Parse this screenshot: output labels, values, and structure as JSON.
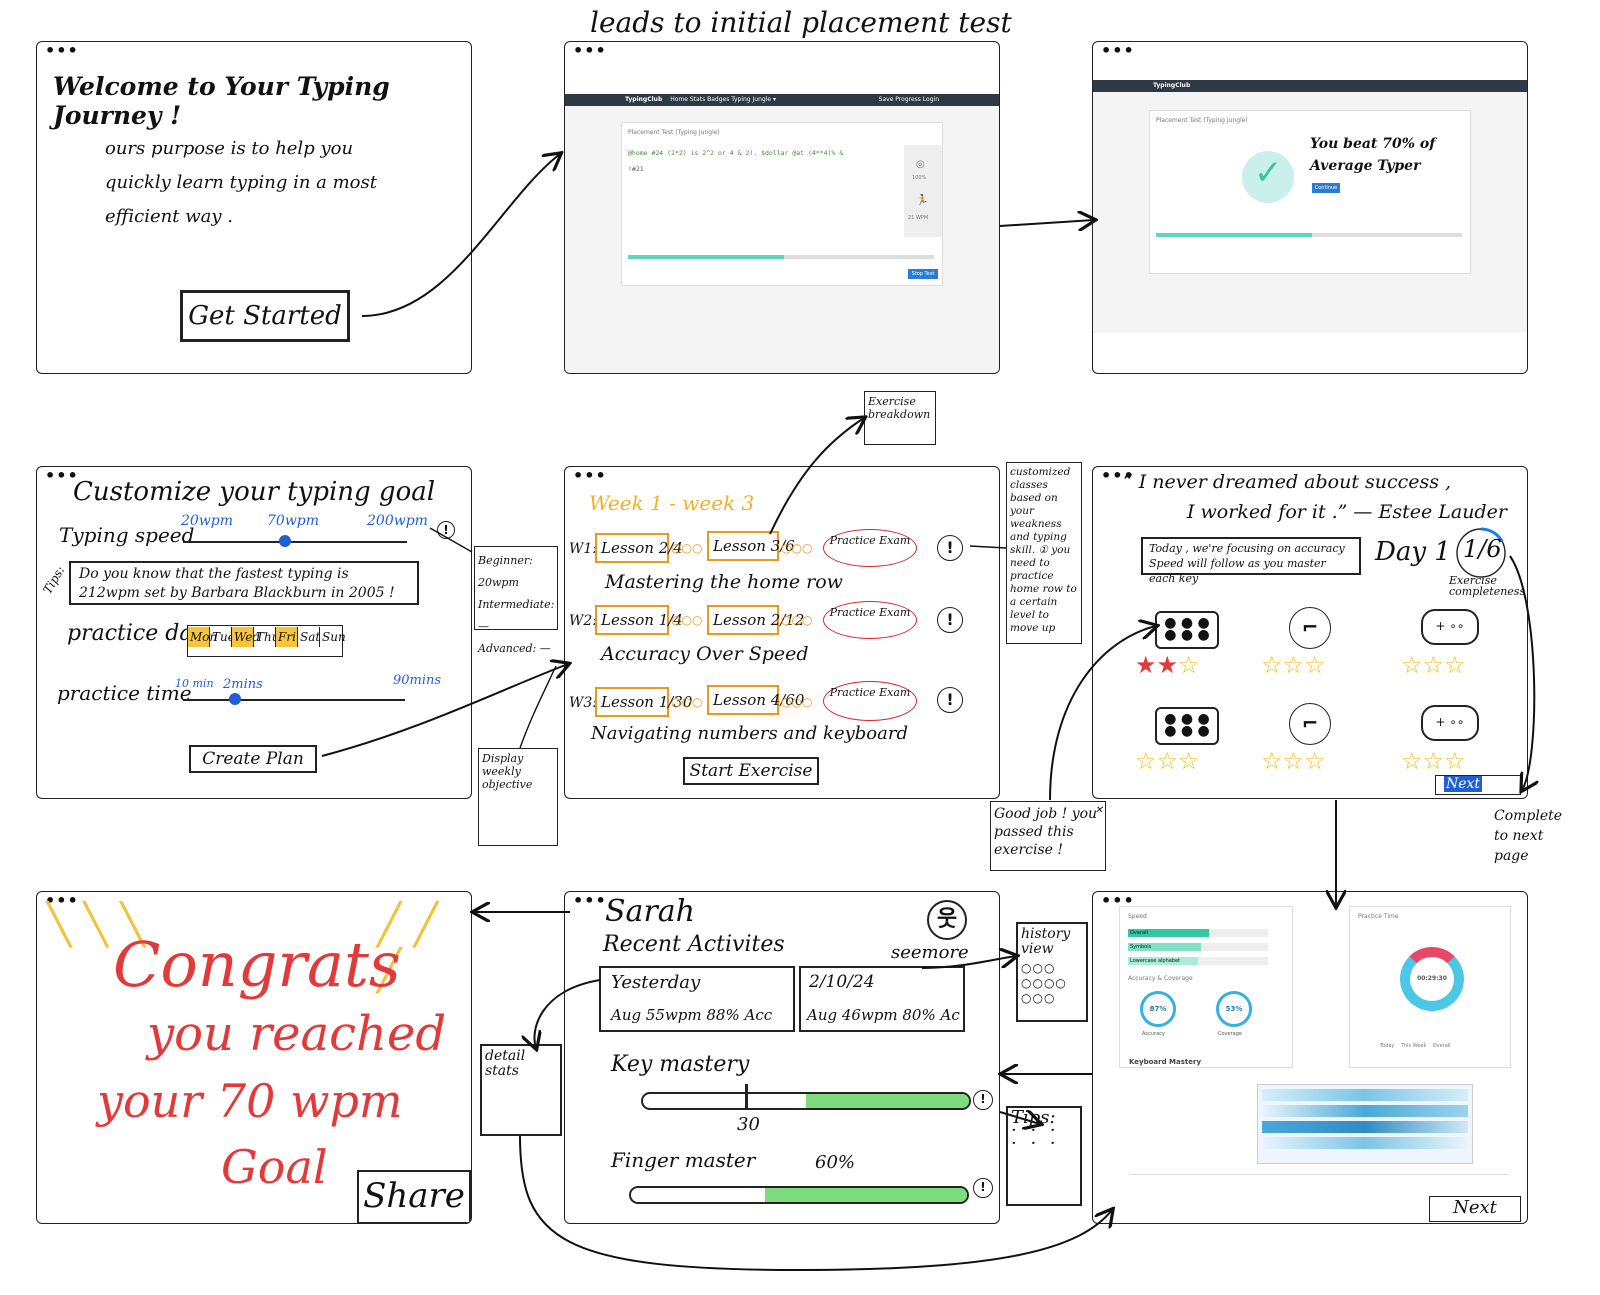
{
  "top_label": "leads to initial placement test",
  "s1": {
    "title": "Welcome to Your Typing Journey !",
    "body": "ours purpose is to help you quickly learn typing in a most efficient way .",
    "button": "Get Started"
  },
  "s2": {
    "brand": "TypingClub",
    "nav": "Home   Stats   Badges   Typing Jungle ▾",
    "nav_right": "Save Progress   Login",
    "card_title": "Placement Test (Typing Jungle)",
    "typing_text": "@home #24 (2*2) is 2^2 or 4 & 2!. $dollar @at (4**4)% &",
    "typing_text2": "!#21",
    "acc": "100%",
    "wpm": "21 WPM",
    "stop": "Stop Test"
  },
  "s3": {
    "brand": "TypingClub",
    "card_title": "Placement Test (Typing Jungle)",
    "result": "You beat 70% of Average Typer",
    "button": "Continue"
  },
  "s4": {
    "title": "Customize your typing goal",
    "speed_label": "Typing speed",
    "speed_ticks": [
      "20wpm",
      "70wpm",
      "200wpm"
    ],
    "tips_label": "Tips:",
    "tip": "Do you know that the fastest typing is 212wpm set by Barbara Blackburn in 2005 !",
    "tip_highlight": "212wpm",
    "practice_day_label": "practice day",
    "days": [
      "Mon",
      "Tue",
      "Wed",
      "Thu",
      "Fri",
      "Sat",
      "Sun"
    ],
    "time_label": "practice time",
    "time_ticks": [
      "10 min",
      "2mins",
      "90mins"
    ],
    "button": "Create Plan",
    "note": [
      "Beginner: 20wpm",
      "Intermediate: —",
      "Advanced: —"
    ]
  },
  "s5": {
    "weeks": "Week 1 - week 3",
    "rows": [
      {
        "w": "W1:",
        "a": "Lesson 2/4",
        "b": "Lesson 3/6",
        "c": "Practice Exam",
        "obj": "Mastering the home row"
      },
      {
        "w": "W2:",
        "a": "Lesson 1/4",
        "b": "Lesson 2/12",
        "c": "Practice Exam",
        "obj": "Accuracy Over Speed"
      },
      {
        "w": "W3:",
        "a": "Lesson 1/30",
        "b": "Lesson 4/60",
        "c": "Practice Exam",
        "obj": "Navigating numbers and keyboard"
      }
    ],
    "button": "Start Exercise",
    "note_top": "Exercise breakdown",
    "note_right": "customized classes based on your weakness and typing skill. ① you need to practice home row to a certain level to move up",
    "note_bottom": "Display weekly objective"
  },
  "s6": {
    "quote1": "“ I never dreamed about success ,",
    "quote2": "I worked for it .” — Estee Lauder",
    "focus": "Today , we're focusing on accuracy Speed will follow as you master each key",
    "day": "Day 1",
    "progress": "1/6",
    "progress_frac": 0.17,
    "completes": "Exercise completeness",
    "next": "Next",
    "popup": "Good job ! you passed this exercise !",
    "note_right": "Complete to next page"
  },
  "s7": {
    "text1": "Congrats",
    "text2": "you reached",
    "text3": "your 70 wpm",
    "text4": "Goal",
    "button": "Share"
  },
  "s8": {
    "name": "Sarah",
    "recent": "Recent Activites",
    "seemore": "seemore",
    "a1_title": "Yesterday",
    "a1_stats": "Aug 55wpm  88% Acc",
    "a2_title": "2/10/24",
    "a2_stats": "Aug 46wpm  80% Ac",
    "key_mastery": "Key mastery",
    "key_value": "30",
    "key_frac": 0.5,
    "finger_mastery": "Finger master",
    "finger_value": "60%",
    "finger_frac": 0.6,
    "note_history": "history view",
    "note_detail": "detail stats",
    "note_tips": "Tips:"
  },
  "s9": {
    "speed": "Speed",
    "speed_rows": [
      "Overall",
      "Symbols",
      "Lowercase alphabet"
    ],
    "practice_time": "Practice Time",
    "time_center": "00:29:30",
    "acc_cov": "Accuracy & Coverage",
    "acc": "87%",
    "cov": "53%",
    "acc_label": "Accuracy",
    "cov_label": "Coverage",
    "keyboard": "Keyboard Mastery",
    "tabs": [
      "Today",
      "This Week",
      "Overall"
    ],
    "next": "Next"
  }
}
